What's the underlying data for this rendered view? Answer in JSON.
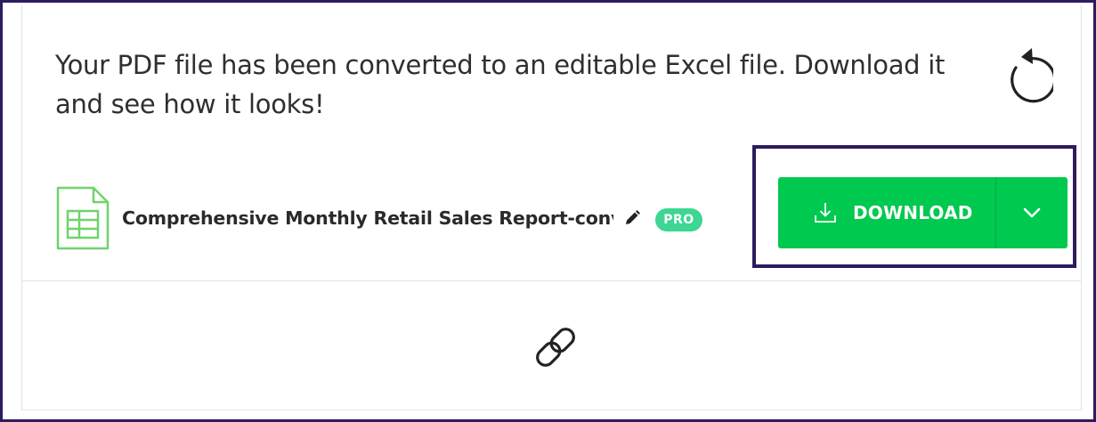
{
  "result": {
    "message": "Your PDF file has been converted to an editable Excel file. Download it and see how it looks!",
    "restart_icon": "restart-icon"
  },
  "file": {
    "icon": "spreadsheet-file-icon",
    "name": "Comprehensive Monthly Retail Sales Report-converted",
    "edit_icon": "pencil-icon",
    "badge": "PRO"
  },
  "download": {
    "label": "DOWNLOAD",
    "icon": "download-icon",
    "dropdown_icon": "chevron-down-icon",
    "color": "#00c94f"
  },
  "share": {
    "icon": "link-icon"
  },
  "colors": {
    "highlight_border": "#2d1b5e",
    "badge_bg": "#3dd693",
    "file_icon": "#6fd46b"
  }
}
